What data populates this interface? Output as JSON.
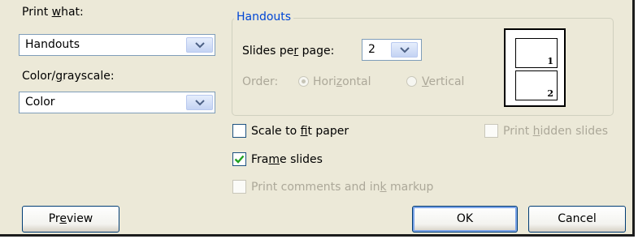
{
  "print_what": {
    "label_pre": "Print ",
    "label_key": "w",
    "label_post": "hat:",
    "value": "Handouts"
  },
  "color": {
    "label_pre": "Color/",
    "label_key": "g",
    "label_post": "rayscale:",
    "value": "Color"
  },
  "handouts": {
    "legend": "Handouts",
    "slides_per_page": {
      "label_pre": "Slides pe",
      "label_key": "r",
      "label_post": " page:",
      "value": "2"
    },
    "order": {
      "label": "Order:",
      "horizontal": {
        "pre": "Hori",
        "key": "z",
        "post": "ontal",
        "selected": true
      },
      "vertical": {
        "pre": "",
        "key": "V",
        "post": "ertical",
        "selected": false
      }
    },
    "preview_pages": [
      "1",
      "2"
    ]
  },
  "options": {
    "scale_to_fit": {
      "pre": "Scale to ",
      "key": "f",
      "post": "it paper",
      "checked": false,
      "enabled": true
    },
    "print_hidden": {
      "pre": "Print ",
      "key": "h",
      "post": "idden slides",
      "checked": false,
      "enabled": false
    },
    "frame_slides": {
      "pre": "Fra",
      "key": "m",
      "post": "e slides",
      "checked": true,
      "enabled": true
    },
    "comments": {
      "pre": "Print comments and in",
      "key": "k",
      "post": " markup",
      "checked": false,
      "enabled": false
    }
  },
  "buttons": {
    "preview": {
      "pre": "Pr",
      "key": "e",
      "post": "view"
    },
    "ok": "OK",
    "cancel": "Cancel"
  },
  "colors": {
    "face": "#ece9d8",
    "accent": "#0046d5",
    "disabled": "#aca899",
    "check": "#21a121"
  }
}
